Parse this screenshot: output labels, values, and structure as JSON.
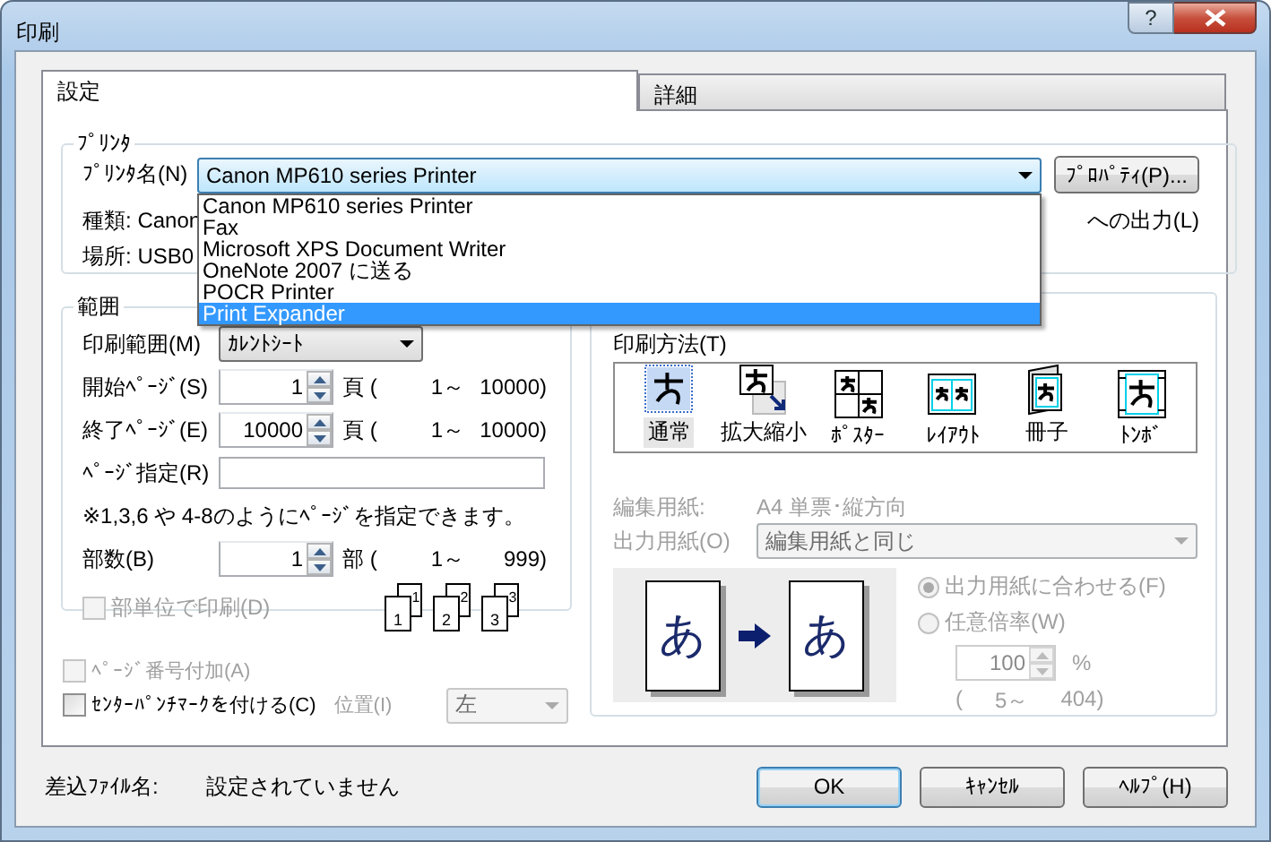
{
  "window": {
    "title": "印刷",
    "help_glyph": "?"
  },
  "tabs": [
    {
      "label": "設定",
      "selected": true
    },
    {
      "label": "詳細",
      "selected": false
    }
  ],
  "printer": {
    "title": "ﾌﾟﾘﾝﾀ",
    "name_label": "ﾌﾟﾘﾝﾀ名(N)",
    "name_value": "Canon MP610 series Printer",
    "expanded": true,
    "properties_button": "ﾌﾟﾛﾊﾟﾃｨ(P)...",
    "type_label": "種類:",
    "type_value": "Canon",
    "location_label": "場所:",
    "location_value": "USB0",
    "output_text": "への出力(L)",
    "options": [
      {
        "label": "Canon MP610 series Printer",
        "selected": false
      },
      {
        "label": "Fax",
        "selected": false
      },
      {
        "label": "Microsoft XPS Document Writer",
        "selected": false
      },
      {
        "label": "OneNote 2007 に送る",
        "selected": false
      },
      {
        "label": "POCR Printer",
        "selected": false
      },
      {
        "label": "Print Expander",
        "selected": true
      }
    ]
  },
  "range": {
    "title": "範囲",
    "print_range_label": "印刷範囲(M)",
    "print_range_value": "ｶﾚﾝﾄｼｰﾄ",
    "spinners": [
      {
        "label": "開始ﾍﾟｰｼﾞ(S)",
        "value": "1",
        "unit": "頁 (",
        "min": "1～",
        "max": "10000)"
      },
      {
        "label": "終了ﾍﾟｰｼﾞ(E)",
        "value": "10000",
        "unit": "頁 (",
        "min": "1～",
        "max": "10000)"
      }
    ],
    "page_spec_label": "ﾍﾟｰｼﾞ指定(R)",
    "note": "※1,3,6 や 4-8のようにﾍﾟｰｼﾞを指定できます。",
    "copies": {
      "label": "部数(B)",
      "value": "1",
      "unit": "部 (",
      "min": "1～",
      "max": "999)"
    },
    "collate": {
      "label": "部単位で印刷(D)",
      "checked": false,
      "disabled": true
    },
    "collate_sets": [
      {
        "front": "1",
        "back": "1"
      },
      {
        "front": "2",
        "back": "2"
      },
      {
        "front": "3",
        "back": "3"
      }
    ]
  },
  "options": [
    {
      "label": "ﾍﾟｰｼﾞ番号付加(A)",
      "checked": false,
      "disabled": true
    },
    {
      "label": "ｾﾝﾀｰﾊﾟﾝﾁﾏｰｸを付ける(C)",
      "checked": false,
      "disabled": false
    }
  ],
  "position": {
    "label": "位置(I)",
    "value": "左",
    "disabled": true
  },
  "method": {
    "title": "印刷方法(T)",
    "items": [
      {
        "label": "通常",
        "kind": "normal",
        "selected": true
      },
      {
        "label": "拡大縮小",
        "kind": "scale",
        "selected": false
      },
      {
        "label": "ﾎﾟｽﾀｰ",
        "kind": "poster",
        "selected": false
      },
      {
        "label": "ﾚｲｱｳﾄ",
        "kind": "layout",
        "selected": false
      },
      {
        "label": "冊子",
        "kind": "booklet",
        "selected": false
      },
      {
        "label": "ﾄﾝﾎﾞ",
        "kind": "trim",
        "selected": false
      }
    ],
    "edit_paper_label": "編集用紙:",
    "edit_paper_value": "A4 単票･縦方向",
    "output_paper_label": "出力用紙(O)",
    "output_paper_value": "編集用紙と同じ",
    "disabled": true,
    "preview_glyphs": [
      "あ",
      "あ"
    ],
    "radios": [
      {
        "label": "出力用紙に合わせる(F)",
        "selected": true
      },
      {
        "label": "任意倍率(W)",
        "selected": false
      }
    ],
    "scale": {
      "value": "100",
      "unit": "%",
      "open": "(",
      "min": "5～",
      "max": "404)"
    }
  },
  "merge_file": {
    "label": "差込ﾌｧｲﾙ名:",
    "value": "設定されていません"
  },
  "buttons": [
    {
      "label": "OK",
      "default": true
    },
    {
      "label": "ｷｬﾝｾﾙ",
      "default": false
    },
    {
      "label": "ﾍﾙﾌﾟ(H)",
      "default": false
    }
  ]
}
